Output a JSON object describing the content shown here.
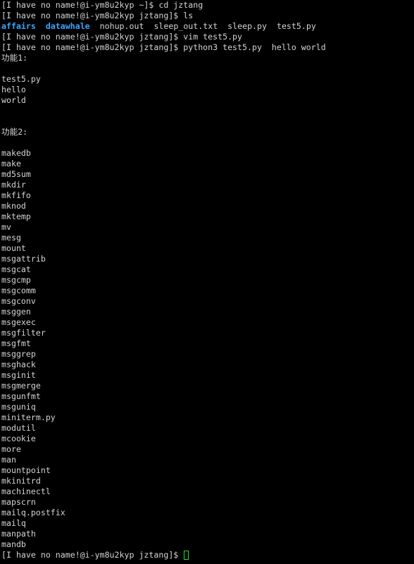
{
  "terminal": {
    "colors": {
      "background": "#000000",
      "text": "#d4d4d4",
      "directory": "#3aa6ff",
      "cursor": "#22e022"
    },
    "lines": [
      {
        "text": "[I have no name!@i-ym8u2kyp ~]$ cd jztang"
      },
      {
        "text": "[I have no name!@i-ym8u2kyp jztang]$ ls"
      },
      {
        "ls": [
          {
            "name": "affairs",
            "dir": true
          },
          {
            "name": "datawhale",
            "dir": true
          },
          {
            "name": "nohup.out"
          },
          {
            "name": "sleep_out.txt"
          },
          {
            "name": "sleep.py"
          },
          {
            "name": "test5.py"
          }
        ]
      },
      {
        "text": "[I have no name!@i-ym8u2kyp jztang]$ vim test5.py"
      },
      {
        "text": "[I have no name!@i-ym8u2kyp jztang]$ python3 test5.py  hello world"
      },
      {
        "text": "功能1:"
      },
      {
        "text": ""
      },
      {
        "text": "test5.py"
      },
      {
        "text": "hello"
      },
      {
        "text": "world"
      },
      {
        "text": ""
      },
      {
        "text": ""
      },
      {
        "text": "功能2:"
      },
      {
        "text": ""
      },
      {
        "text": "makedb"
      },
      {
        "text": "make"
      },
      {
        "text": "md5sum"
      },
      {
        "text": "mkdir"
      },
      {
        "text": "mkfifo"
      },
      {
        "text": "mknod"
      },
      {
        "text": "mktemp"
      },
      {
        "text": "mv"
      },
      {
        "text": "mesg"
      },
      {
        "text": "mount"
      },
      {
        "text": "msgattrib"
      },
      {
        "text": "msgcat"
      },
      {
        "text": "msgcmp"
      },
      {
        "text": "msgcomm"
      },
      {
        "text": "msgconv"
      },
      {
        "text": "msggen"
      },
      {
        "text": "msgexec"
      },
      {
        "text": "msgfilter"
      },
      {
        "text": "msgfmt"
      },
      {
        "text": "msggrep"
      },
      {
        "text": "msghack"
      },
      {
        "text": "msginit"
      },
      {
        "text": "msgmerge"
      },
      {
        "text": "msgunfmt"
      },
      {
        "text": "msguniq"
      },
      {
        "text": "miniterm.py"
      },
      {
        "text": "modutil"
      },
      {
        "text": "mcookie"
      },
      {
        "text": "more"
      },
      {
        "text": "man"
      },
      {
        "text": "mountpoint"
      },
      {
        "text": "mkinitrd"
      },
      {
        "text": "machinectl"
      },
      {
        "text": "mapscrn"
      },
      {
        "text": "mailq.postfix"
      },
      {
        "text": "mailq"
      },
      {
        "text": "manpath"
      },
      {
        "text": "mandb"
      }
    ],
    "prompt": "[I have no name!@i-ym8u2kyp jztang]$ "
  }
}
